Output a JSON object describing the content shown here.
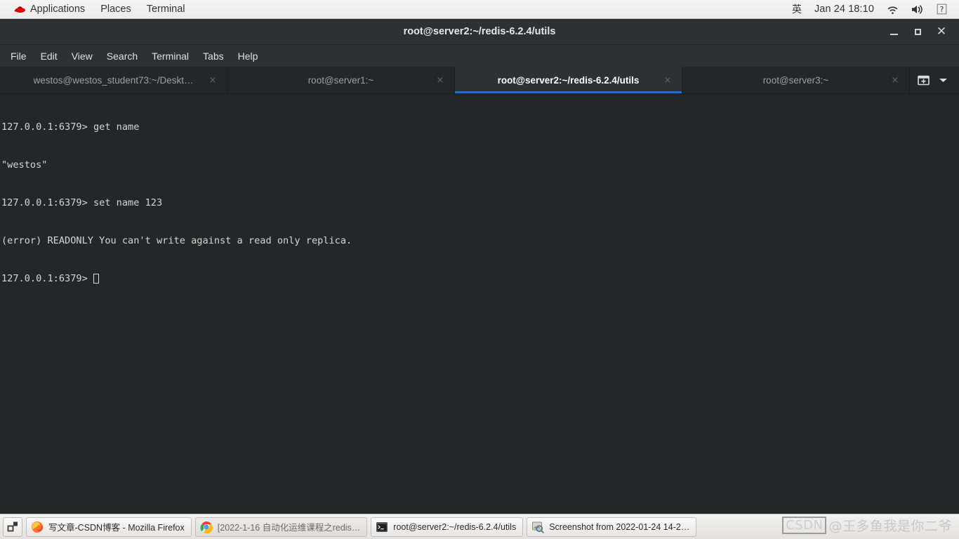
{
  "top_panel": {
    "applications_label": "Applications",
    "places_label": "Places",
    "terminal_label": "Terminal",
    "ime_label": "英",
    "clock": "Jan 24 18:10",
    "logo_name": "red-hat-logo",
    "tray": {
      "network_icon": "wifi-icon",
      "volume_icon": "volume-icon",
      "help_icon": "help-icon"
    }
  },
  "window": {
    "title": "root@server2:~/redis-6.2.4/utils",
    "controls": {
      "minimize": "minimize-button",
      "maximize": "maximize-button",
      "close": "close-button"
    }
  },
  "menubar": {
    "items": [
      {
        "label": "File"
      },
      {
        "label": "Edit"
      },
      {
        "label": "View"
      },
      {
        "label": "Search"
      },
      {
        "label": "Terminal"
      },
      {
        "label": "Tabs"
      },
      {
        "label": "Help"
      }
    ]
  },
  "tabbar": {
    "tabs": [
      {
        "label": "westos@westos_student73:~/Deskt…",
        "active": false
      },
      {
        "label": "root@server1:~",
        "active": false
      },
      {
        "label": "root@server2:~/redis-6.2.4/utils",
        "active": true
      },
      {
        "label": "root@server3:~",
        "active": false
      }
    ],
    "close_glyph": "×",
    "new_tab_icon": "new-terminal-tab-icon",
    "dropdown_icon": "chevron-down-icon",
    "active_accent_color": "#2a6cc4"
  },
  "terminal": {
    "background_color": "#23272a",
    "foreground_color": "#d6d6d6",
    "lines": [
      "127.0.0.1:6379> get name",
      "\"westos\"",
      "127.0.0.1:6379> set name 123",
      "(error) READONLY You can't write against a read only replica.",
      "127.0.0.1:6379> "
    ],
    "prompt": "127.0.0.1:6379> ",
    "cursor": "block-outline"
  },
  "taskbar": {
    "show_desktop_icon": "show-desktop-icon",
    "items": [
      {
        "label": "写文章-CSDN博客 - Mozilla Firefox",
        "icon": "firefox-icon",
        "active": true
      },
      {
        "label": "[2022-1-16 自动化运维课程之redis…",
        "icon": "chrome-icon",
        "active": false
      },
      {
        "label": "root@server2:~/redis-6.2.4/utils",
        "icon": "terminal-icon",
        "active": true
      },
      {
        "label": "Screenshot from 2022-01-24 14-2…",
        "icon": "image-viewer-icon",
        "active": true
      }
    ]
  },
  "watermark": {
    "brand": "CSDN",
    "handle": "@王多鱼我是你二爷"
  }
}
